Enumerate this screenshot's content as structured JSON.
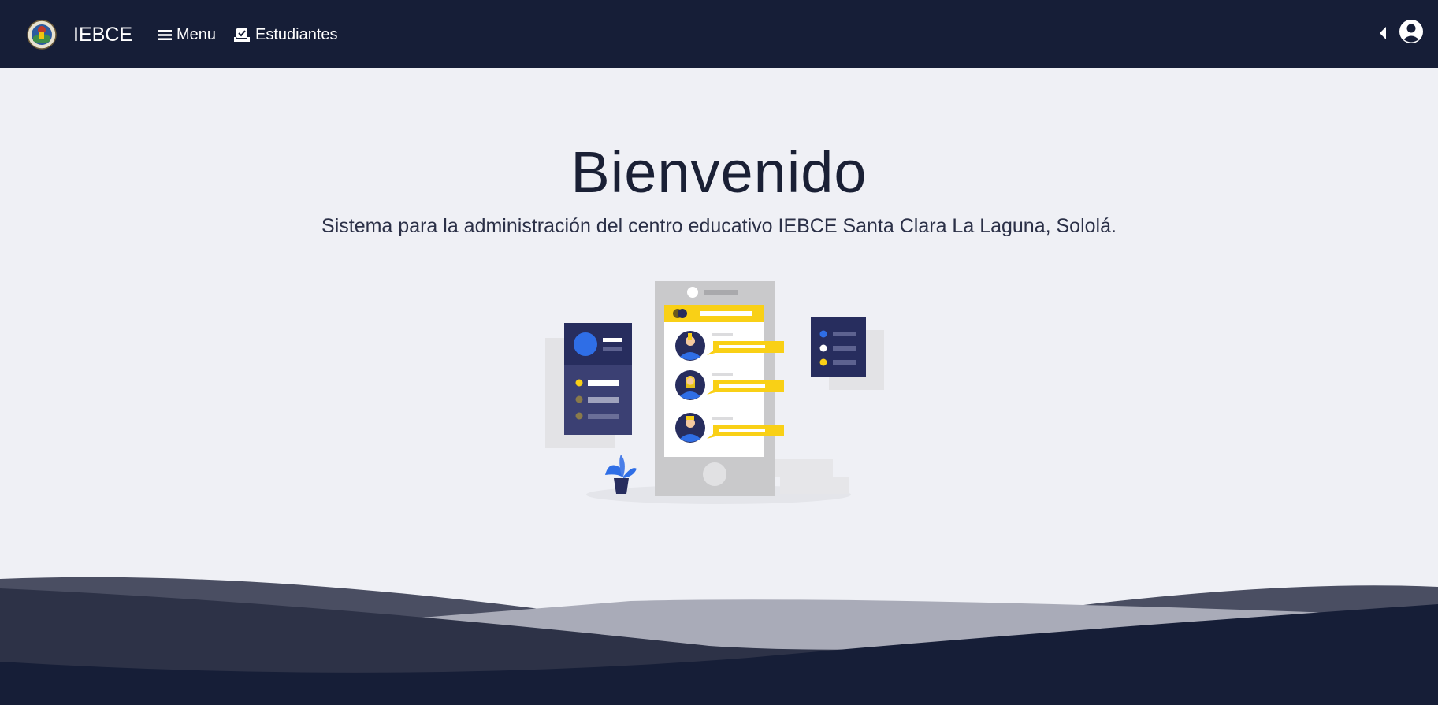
{
  "navbar": {
    "brand": "IEBCE",
    "menu_label": "Menu",
    "students_label": "Estudiantes",
    "logo_icon": "school-seal-logo",
    "menu_icon": "hamburger-icon",
    "students_icon": "checkbox-tray-icon",
    "collapse_icon": "caret-left-icon",
    "user_icon": "user-circle-icon"
  },
  "hero": {
    "title": "Bienvenido",
    "subtitle": "Sistema para la administración del centro educativo IEBCE Santa Clara La Laguna, Sololá."
  },
  "colors": {
    "navbar_bg": "#161e37",
    "page_bg": "#eff0f5",
    "accent_yellow": "#f9d016",
    "accent_blue": "#2f6ee6",
    "panel_navy": "#272d5e"
  }
}
